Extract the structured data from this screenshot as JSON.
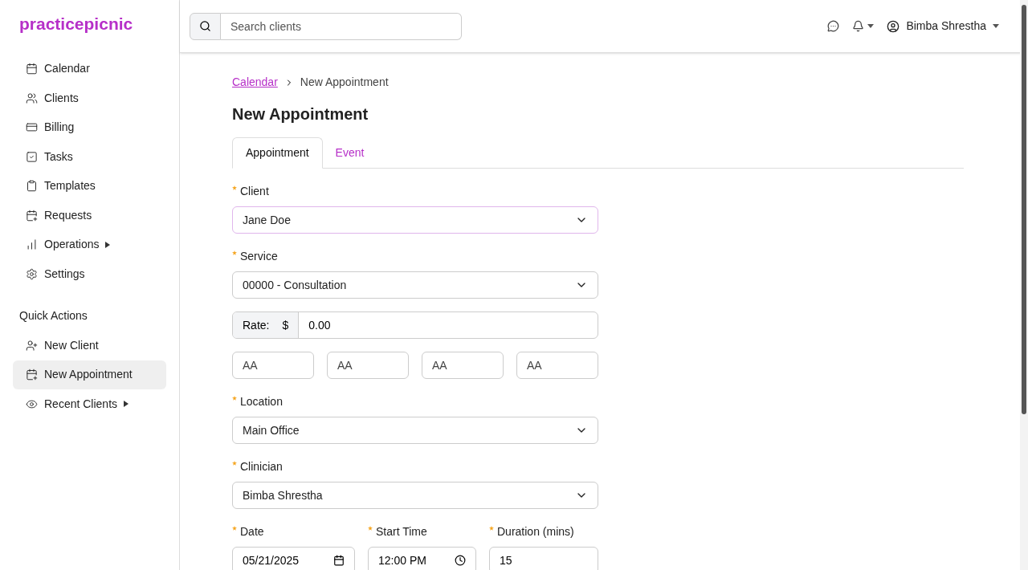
{
  "brand": "practicepicnic",
  "sidebar": {
    "items": [
      {
        "label": "Calendar",
        "submenu": false,
        "selected": false
      },
      {
        "label": "Clients",
        "submenu": false,
        "selected": false
      },
      {
        "label": "Billing",
        "submenu": false,
        "selected": false
      },
      {
        "label": "Tasks",
        "submenu": false,
        "selected": false
      },
      {
        "label": "Templates",
        "submenu": false,
        "selected": false
      },
      {
        "label": "Requests",
        "submenu": false,
        "selected": false
      },
      {
        "label": "Operations",
        "submenu": true,
        "selected": false
      },
      {
        "label": "Settings",
        "submenu": false,
        "selected": false
      }
    ],
    "quick_actions_title": "Quick Actions",
    "quick_actions": [
      {
        "label": "New Client",
        "submenu": false,
        "selected": false
      },
      {
        "label": "New Appointment",
        "submenu": false,
        "selected": true
      },
      {
        "label": "Recent Clients",
        "submenu": true,
        "selected": false
      }
    ]
  },
  "topbar": {
    "search": {
      "placeholder": "Search clients"
    },
    "user": "Bimba Shrestha"
  },
  "breadcrumb": {
    "link": "Calendar",
    "current": "New Appointment"
  },
  "title": "New Appointment",
  "tabs": [
    {
      "label": "Appointment",
      "selected": true
    },
    {
      "label": "Event",
      "selected": false
    }
  ],
  "form": {
    "client": {
      "label": "Client",
      "required": true,
      "value": "Jane Doe"
    },
    "service": {
      "label": "Service",
      "required": true,
      "value": "00000 - Consultation"
    },
    "rate": {
      "label": "Rate:",
      "currency": "$",
      "value": "0.00"
    },
    "codes": [
      "AA",
      "AA",
      "AA",
      "AA"
    ],
    "location": {
      "label": "Location",
      "required": true,
      "value": "Main Office"
    },
    "clinician": {
      "label": "Clinician",
      "required": true,
      "value": "Bimba Shrestha"
    },
    "date": {
      "label": "Date",
      "required": true,
      "value": "05/21/2025"
    },
    "start_time": {
      "label": "Start Time",
      "required": true,
      "value": "12:00 PM"
    },
    "duration": {
      "label": "Duration (mins)",
      "required": true,
      "value": "15"
    }
  }
}
